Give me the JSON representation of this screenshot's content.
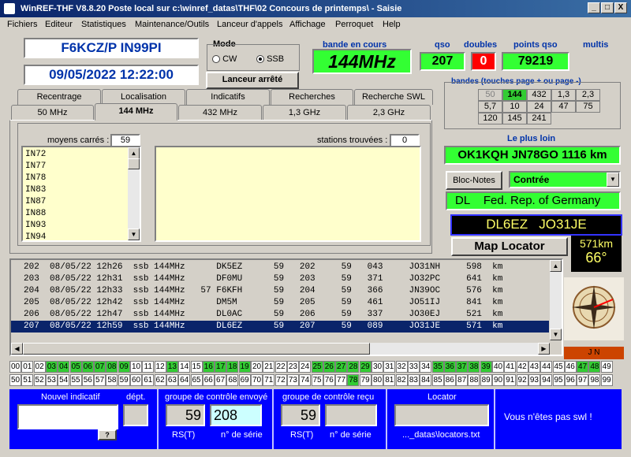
{
  "window": {
    "title": "WinREF-THF V8.8.20 Poste local sur c:\\winref_datas\\THF\\02 Concours de printemps\\ -  Saisie",
    "min": "_",
    "max": "□",
    "close": "X"
  },
  "menu": [
    "Fichiers",
    "Editeur",
    "Statistiques",
    "Maintenance/Outils",
    "Lanceur d'appels",
    "Affichage",
    "Perroquet",
    "Help"
  ],
  "station": {
    "call": "F6KCZ/P  IN99PI",
    "datetime": "09/05/2022   12:22:00"
  },
  "mode": {
    "label": "Mode",
    "cw": "CW",
    "ssb": "SSB",
    "selected": "SSB"
  },
  "launcher": "Lanceur arrêté",
  "stats": {
    "band_label": "bande en cours",
    "band": "144MHz",
    "qso_label": "qso",
    "qso": "207",
    "doubles_label": "doubles",
    "doubles": "0",
    "points_label": "points qso",
    "points": "79219",
    "multis_label": "multis"
  },
  "bands_panel": {
    "label": "bandes (touches page + ou page -)",
    "rows": [
      [
        "50",
        "144",
        "432",
        "1,3",
        "2,3"
      ],
      [
        "5,7",
        "10",
        "24",
        "47",
        "75"
      ],
      [
        "120",
        "145",
        "241"
      ]
    ],
    "active": "144"
  },
  "farthest": {
    "label": "Le plus loin",
    "value": "OK1KQH JN78GO  1116 km"
  },
  "bloc_notes": "Bloc-Notes",
  "contree_select": "Contrée",
  "country": {
    "prefix": "DL",
    "name": "Fed. Rep. of Germany"
  },
  "current": {
    "call": "DL6EZ",
    "locator": "JO31JE",
    "distance": "571km",
    "azimuth": "66°"
  },
  "map_button": "Map Locator",
  "compass_label": "J N",
  "tabs_row1": [
    "Recentrage",
    "Localisation",
    "Indicatifs",
    "Recherches",
    "Recherche SWL"
  ],
  "tabs_row2": [
    "50 MHz",
    "144 MHz",
    "432 MHz",
    "1,3 GHz",
    "2,3 GHz"
  ],
  "tab_active": "144 MHz",
  "squares": {
    "label": "moyens carrés :",
    "count": "59",
    "items": [
      "IN72",
      "IN77",
      "IN78",
      "IN83",
      "IN87",
      "IN88",
      "IN93",
      "IN94"
    ]
  },
  "stations": {
    "label": "stations trouvées :",
    "count": "0"
  },
  "log": [
    "202  08/05/22 12h26  ssb 144MHz      DK5EZ      59   202     59   043     JO31NH     598  km",
    "203  08/05/22 12h31  ssb 144MHz      DF0MU      59   203     59   371     JO32PC     641  km",
    "204  08/05/22 12h33  ssb 144MHz   57 F6KFH      59   204     59   366     JN39OC     576  km",
    "205  08/05/22 12h42  ssb 144MHz      DM5M       59   205     59   461     JO51IJ     841  km",
    "206  08/05/22 12h47  ssb 144MHz      DL0AC      59   206     59   337     JO30EJ     521  km",
    "207  08/05/22 12h59  ssb 144MHz      DL6EZ      59   207     59   089     JO31JE     571  km"
  ],
  "numbers_row1": [
    "00",
    "01",
    "02",
    "03",
    "04",
    "05",
    "06",
    "07",
    "08",
    "09",
    "10",
    "11",
    "12",
    "13",
    "14",
    "15",
    "16",
    "17",
    "18",
    "19",
    "20",
    "21",
    "22",
    "23",
    "24",
    "25",
    "26",
    "27",
    "28",
    "29",
    "30",
    "31",
    "32",
    "33",
    "34",
    "35",
    "36",
    "37",
    "38",
    "39",
    "40",
    "41",
    "42",
    "43",
    "44",
    "45",
    "46",
    "47",
    "48",
    "49"
  ],
  "numbers_row2": [
    "50",
    "51",
    "52",
    "53",
    "54",
    "55",
    "56",
    "57",
    "58",
    "59",
    "60",
    "61",
    "62",
    "63",
    "64",
    "65",
    "66",
    "67",
    "68",
    "69",
    "70",
    "71",
    "72",
    "73",
    "74",
    "75",
    "76",
    "77",
    "78",
    "79",
    "80",
    "81",
    "82",
    "83",
    "84",
    "85",
    "86",
    "87",
    "88",
    "89",
    "90",
    "91",
    "92",
    "93",
    "94",
    "95",
    "96",
    "97",
    "98",
    "99"
  ],
  "numbers_green": [
    "03",
    "04",
    "05",
    "06",
    "07",
    "08",
    "09",
    "13",
    "16",
    "17",
    "18",
    "19",
    "25",
    "26",
    "27",
    "28",
    "29",
    "35",
    "36",
    "37",
    "38",
    "39",
    "47",
    "48",
    "78"
  ],
  "entry": {
    "new_call_label": "Nouvel indicatif",
    "dept_label": "dépt.",
    "help": "?",
    "sent_label": "groupe de contrôle envoyé",
    "sent_rst": "59",
    "sent_serial": "208",
    "rst_label": "RS(T)",
    "serial_label": "n° de série",
    "recv_label": "groupe de contrôle reçu",
    "recv_rst": "59",
    "locator_label": "Locator",
    "locator_file": "..._datas\\locators.txt",
    "swl": "Vous n'êtes pas swl !"
  },
  "colors": {
    "title_blue": "#0a246a",
    "panel_blue": "#0000ff",
    "green": "#33ff33",
    "select_row": "#0a246a",
    "yellow": "#ffffcc"
  }
}
